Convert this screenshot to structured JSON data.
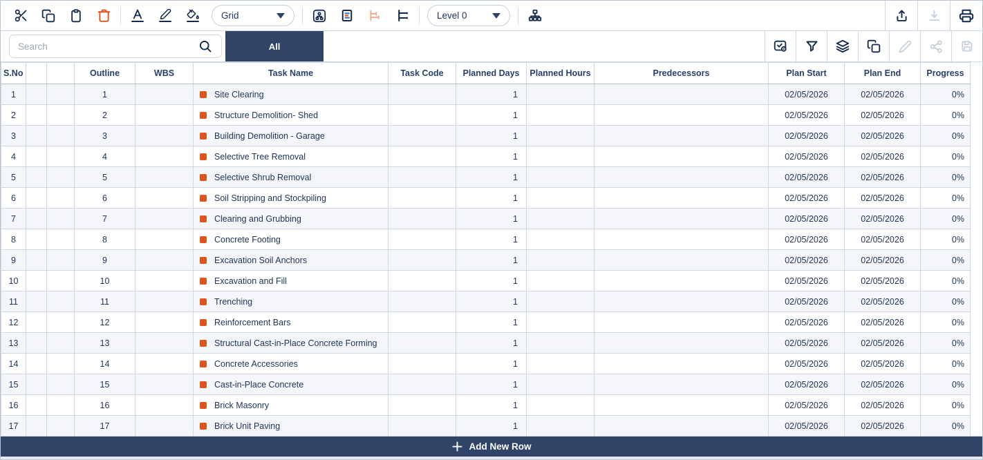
{
  "colors": {
    "accent_orange": "#dd541c",
    "navy_ink": "#1f3358",
    "navy_fill": "#304468",
    "row_alt": "#f4f6fa",
    "border": "#cfd8e4",
    "disabled_icon": "#c6d0dd"
  },
  "toolbar": {
    "icons_left": [
      "cut",
      "copy",
      "paste",
      "delete",
      "text-color",
      "edit-pen",
      "fill-color"
    ],
    "view_dropdown": {
      "value": "Grid"
    },
    "icons_mid": [
      "resource-view",
      "baseline-view",
      "indent-chart",
      "milestone-links",
      "hierarchy"
    ],
    "level_dropdown": {
      "value": "Level 0"
    },
    "icons_right": [
      "upload",
      "download",
      "print"
    ]
  },
  "filterbar": {
    "search_placeholder": "Search",
    "tab_all": "All",
    "icons_right": [
      "select-tasks",
      "filter",
      "layers",
      "duplicate",
      "edit",
      "share",
      "save"
    ]
  },
  "table": {
    "columns": [
      "S.No",
      "",
      "",
      "Outline",
      "WBS",
      "Task Name",
      "Task Code",
      "Planned Days",
      "Planned Hours",
      "Predecessors",
      "Plan Start",
      "Plan End",
      "Progress"
    ],
    "rows": [
      {
        "sno": "1",
        "outline": "1",
        "wbs": "",
        "task": "Site Clearing",
        "task_code": "",
        "planned_days": "1",
        "planned_hours": "",
        "predecessors": "",
        "plan_start": "02/05/2026",
        "plan_end": "02/05/2026",
        "progress": "0%"
      },
      {
        "sno": "2",
        "outline": "2",
        "wbs": "",
        "task": "Structure Demolition- Shed",
        "task_code": "",
        "planned_days": "1",
        "planned_hours": "",
        "predecessors": "",
        "plan_start": "02/05/2026",
        "plan_end": "02/05/2026",
        "progress": "0%"
      },
      {
        "sno": "3",
        "outline": "3",
        "wbs": "",
        "task": "Building Demolition - Garage",
        "task_code": "",
        "planned_days": "1",
        "planned_hours": "",
        "predecessors": "",
        "plan_start": "02/05/2026",
        "plan_end": "02/05/2026",
        "progress": "0%"
      },
      {
        "sno": "4",
        "outline": "4",
        "wbs": "",
        "task": "Selective Tree Removal",
        "task_code": "",
        "planned_days": "1",
        "planned_hours": "",
        "predecessors": "",
        "plan_start": "02/05/2026",
        "plan_end": "02/05/2026",
        "progress": "0%"
      },
      {
        "sno": "5",
        "outline": "5",
        "wbs": "",
        "task": "Selective Shrub Removal",
        "task_code": "",
        "planned_days": "1",
        "planned_hours": "",
        "predecessors": "",
        "plan_start": "02/05/2026",
        "plan_end": "02/05/2026",
        "progress": "0%"
      },
      {
        "sno": "6",
        "outline": "6",
        "wbs": "",
        "task": "Soil Stripping and Stockpiling",
        "task_code": "",
        "planned_days": "1",
        "planned_hours": "",
        "predecessors": "",
        "plan_start": "02/05/2026",
        "plan_end": "02/05/2026",
        "progress": "0%"
      },
      {
        "sno": "7",
        "outline": "7",
        "wbs": "",
        "task": "Clearing and Grubbing",
        "task_code": "",
        "planned_days": "1",
        "planned_hours": "",
        "predecessors": "",
        "plan_start": "02/05/2026",
        "plan_end": "02/05/2026",
        "progress": "0%"
      },
      {
        "sno": "8",
        "outline": "8",
        "wbs": "",
        "task": "Concrete Footing",
        "task_code": "",
        "planned_days": "1",
        "planned_hours": "",
        "predecessors": "",
        "plan_start": "02/05/2026",
        "plan_end": "02/05/2026",
        "progress": "0%"
      },
      {
        "sno": "9",
        "outline": "9",
        "wbs": "",
        "task": "Excavation Soil Anchors",
        "task_code": "",
        "planned_days": "1",
        "planned_hours": "",
        "predecessors": "",
        "plan_start": "02/05/2026",
        "plan_end": "02/05/2026",
        "progress": "0%"
      },
      {
        "sno": "10",
        "outline": "10",
        "wbs": "",
        "task": "Excavation and Fill",
        "task_code": "",
        "planned_days": "1",
        "planned_hours": "",
        "predecessors": "",
        "plan_start": "02/05/2026",
        "plan_end": "02/05/2026",
        "progress": "0%"
      },
      {
        "sno": "11",
        "outline": "11",
        "wbs": "",
        "task": "Trenching",
        "task_code": "",
        "planned_days": "1",
        "planned_hours": "",
        "predecessors": "",
        "plan_start": "02/05/2026",
        "plan_end": "02/05/2026",
        "progress": "0%"
      },
      {
        "sno": "12",
        "outline": "12",
        "wbs": "",
        "task": "Reinforcement Bars",
        "task_code": "",
        "planned_days": "1",
        "planned_hours": "",
        "predecessors": "",
        "plan_start": "02/05/2026",
        "plan_end": "02/05/2026",
        "progress": "0%"
      },
      {
        "sno": "13",
        "outline": "13",
        "wbs": "",
        "task": "Structural Cast-in-Place Concrete Forming",
        "task_code": "",
        "planned_days": "1",
        "planned_hours": "",
        "predecessors": "",
        "plan_start": "02/05/2026",
        "plan_end": "02/05/2026",
        "progress": "0%"
      },
      {
        "sno": "14",
        "outline": "14",
        "wbs": "",
        "task": "Concrete Accessories",
        "task_code": "",
        "planned_days": "1",
        "planned_hours": "",
        "predecessors": "",
        "plan_start": "02/05/2026",
        "plan_end": "02/05/2026",
        "progress": "0%"
      },
      {
        "sno": "15",
        "outline": "15",
        "wbs": "",
        "task": "Cast-in-Place Concrete",
        "task_code": "",
        "planned_days": "1",
        "planned_hours": "",
        "predecessors": "",
        "plan_start": "02/05/2026",
        "plan_end": "02/05/2026",
        "progress": "0%"
      },
      {
        "sno": "16",
        "outline": "16",
        "wbs": "",
        "task": "Brick Masonry",
        "task_code": "",
        "planned_days": "1",
        "planned_hours": "",
        "predecessors": "",
        "plan_start": "02/05/2026",
        "plan_end": "02/05/2026",
        "progress": "0%"
      },
      {
        "sno": "17",
        "outline": "17",
        "wbs": "",
        "task": "Brick Unit Paving",
        "task_code": "",
        "planned_days": "1",
        "planned_hours": "",
        "predecessors": "",
        "plan_start": "02/05/2026",
        "plan_end": "02/05/2026",
        "progress": "0%"
      }
    ]
  },
  "footer": {
    "add_row_label": "Add New Row"
  }
}
